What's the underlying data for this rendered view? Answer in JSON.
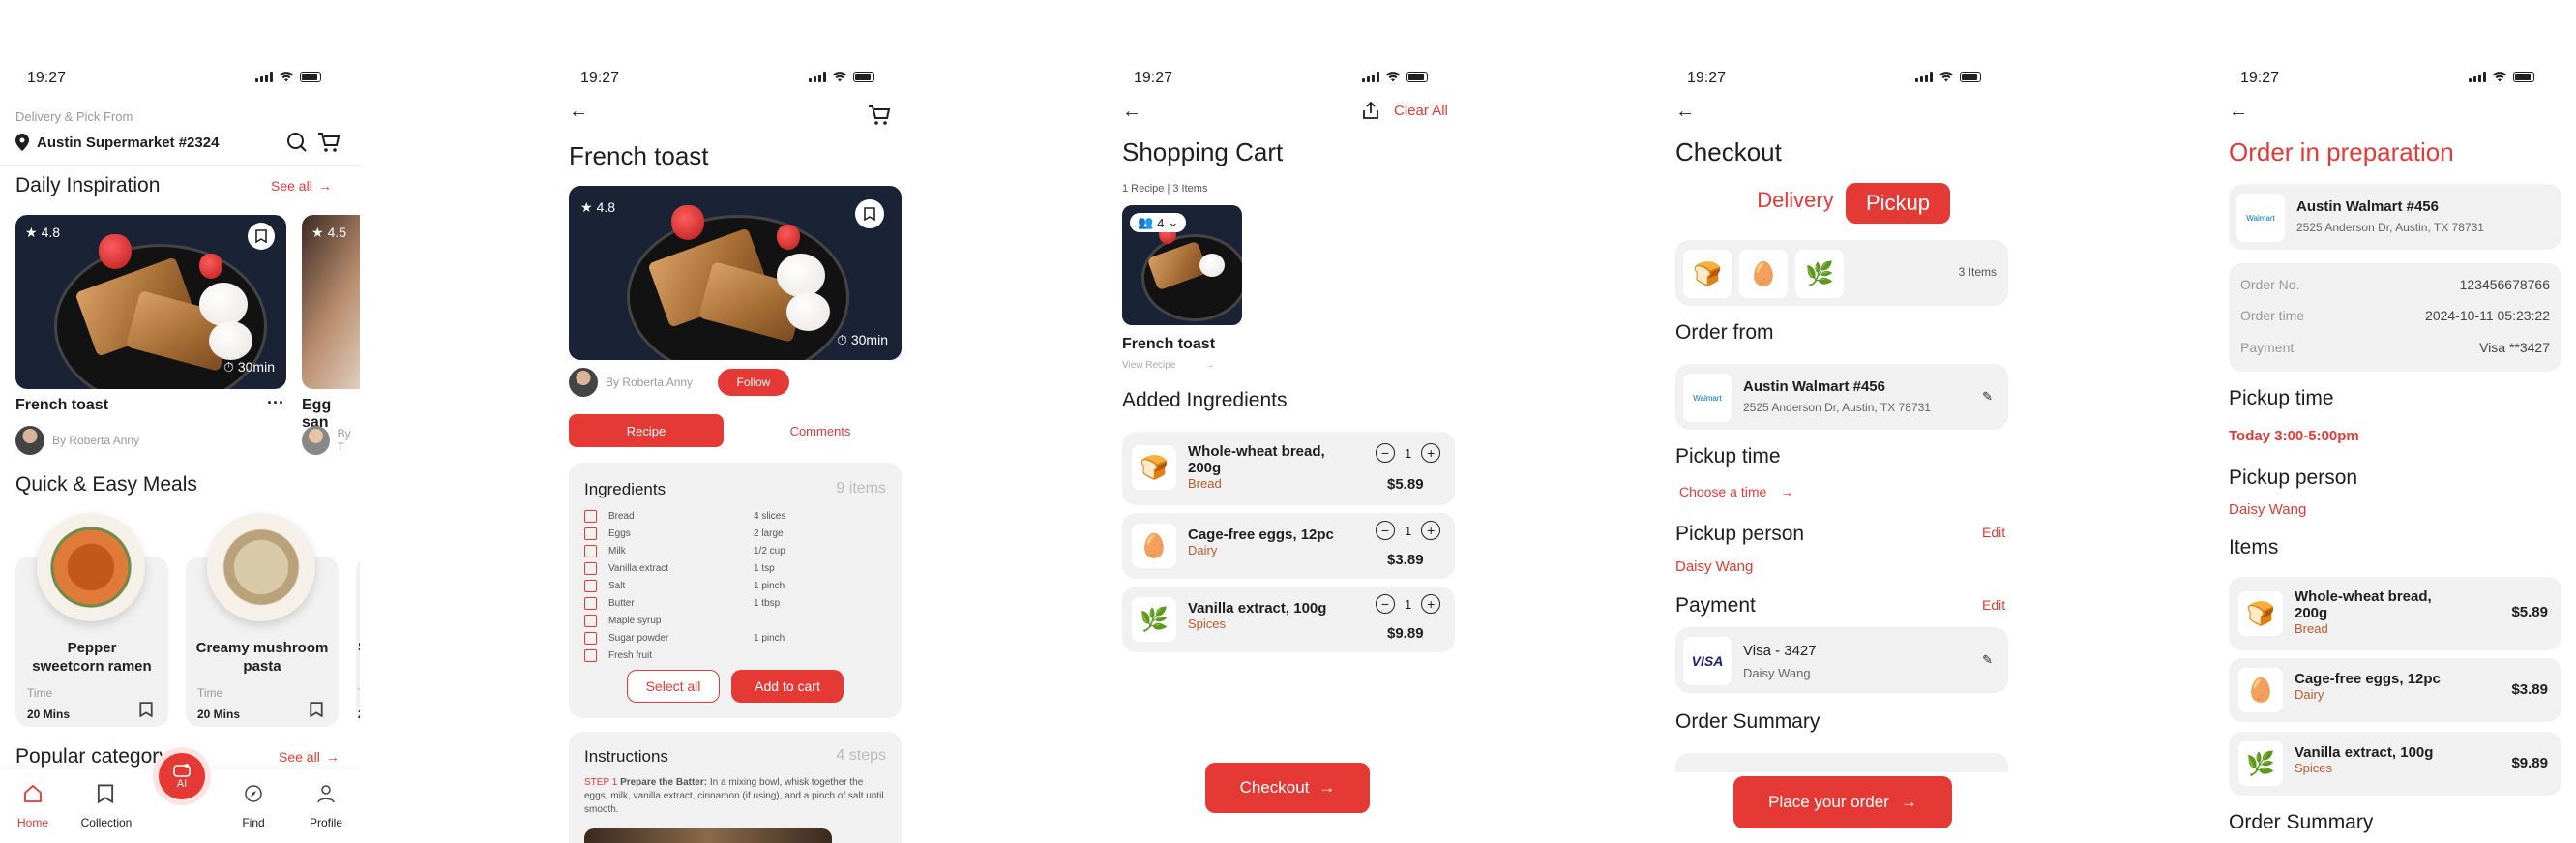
{
  "status_time": "19:27",
  "s1": {
    "location_label": "Delivery & Pick From",
    "store": "Austin Supermarket #2324",
    "daily_title": "Daily Inspiration",
    "see_all": "See all",
    "cards": [
      {
        "rating": "4.8",
        "time": "30min",
        "title": "French toast",
        "author": "By Roberta Anny"
      },
      {
        "rating": "4.5",
        "title": "Egg san",
        "author": "By T"
      }
    ],
    "quick_title": "Quick & Easy Meals",
    "meals": [
      {
        "name": "Pepper sweetcorn ramen",
        "time_label": "Time",
        "time": "20 Mins"
      },
      {
        "name": "Creamy mushroom pasta",
        "time_label": "Time",
        "time": "20 Mins"
      },
      {
        "name": "S",
        "time_label": "T",
        "time": "2"
      }
    ],
    "popular_title": "Popular category",
    "popular_see_all": "See all",
    "tabs": [
      "Home",
      "Collection",
      "AI",
      "Find",
      "Profile"
    ]
  },
  "s2": {
    "title": "French toast",
    "rating": "4.8",
    "time": "30min",
    "author": "By Roberta Anny",
    "follow": "Follow",
    "tab_recipe": "Recipe",
    "tab_comments": "Comments",
    "ingredients_title": "Ingredients",
    "ingredients_count": "9 items",
    "ingredients": [
      {
        "name": "Bread",
        "qty": "4 slices"
      },
      {
        "name": "Eggs",
        "qty": "2 large"
      },
      {
        "name": "Milk",
        "qty": "1/2 cup"
      },
      {
        "name": "Vanilla extract",
        "qty": "1 tsp"
      },
      {
        "name": "Salt",
        "qty": "1 pinch"
      },
      {
        "name": "Butter",
        "qty": "1 tbsp"
      },
      {
        "name": "Maple syrup",
        "qty": ""
      },
      {
        "name": "Sugar powder",
        "qty": "1 pinch"
      },
      {
        "name": "Fresh fruit",
        "qty": ""
      }
    ],
    "select_all": "Select all",
    "add_to_cart": "Add to cart",
    "instructions_title": "Instructions",
    "instructions_count": "4 steps",
    "step_label": "STEP 1",
    "step_title": "Prepare the Batter:",
    "step_text": "In a mixing bowl, whisk together the eggs, milk, vanilla extract, cinnamon (if using), and a pinch of salt until smooth."
  },
  "s3": {
    "clear_all": "Clear All",
    "title": "Shopping Cart",
    "summary": "1 Recipe | 3 Items",
    "servings": "4",
    "recipe_name": "French toast",
    "view_recipe": "View Recipe",
    "added_title": "Added Ingredients",
    "items": [
      {
        "name": "Whole-wheat bread, 200g",
        "cat": "Bread",
        "qty": "1",
        "price": "$5.89",
        "icon": "bread-icon",
        "glyph": "🍞"
      },
      {
        "name": "Cage-free eggs, 12pc",
        "cat": "Dairy",
        "qty": "1",
        "price": "$3.89",
        "icon": "egg-icon",
        "glyph": "🥚"
      },
      {
        "name": "Vanilla extract, 100g",
        "cat": "Spices",
        "qty": "1",
        "price": "$9.89",
        "icon": "herb-icon",
        "glyph": "🌿"
      }
    ],
    "checkout": "Checkout"
  },
  "s4": {
    "title": "Checkout",
    "delivery": "Delivery",
    "pickup": "Pickup",
    "items_count": "3 Items",
    "order_from": "Order from",
    "store_logo": "Walmart",
    "store_name": "Austin Walmart #456",
    "store_addr": "2525 Anderson Dr, Austin, TX 78731",
    "pickup_time": "Pickup time",
    "choose_time": "Choose a time",
    "pickup_person": "Pickup person",
    "edit": "Edit",
    "person": "Daisy Wang",
    "payment": "Payment",
    "payment_edit": "Edit",
    "card_brand": "VISA",
    "card_name": "Visa - 3427",
    "card_holder": "Daisy Wang",
    "order_summary": "Order Summary",
    "place_order": "Place your order"
  },
  "s5": {
    "title": "Order in preparation",
    "store_logo": "Walmart",
    "store_name": "Austin Walmart #456",
    "store_addr": "2525 Anderson Dr, Austin, TX 78731",
    "details": [
      {
        "label": "Order No.",
        "value": "123456678766"
      },
      {
        "label": "Order time",
        "value": "2024-10-11 05:23:22"
      },
      {
        "label": "Payment",
        "value": "Visa **3427"
      }
    ],
    "pickup_time": "Pickup time",
    "pickup_time_value": "Today 3:00-5:00pm",
    "pickup_person": "Pickup person",
    "person": "Daisy Wang",
    "items_title": "Items",
    "items": [
      {
        "name": "Whole-wheat bread, 200g",
        "cat": "Bread",
        "price": "$5.89",
        "glyph": "🍞"
      },
      {
        "name": "Cage-free eggs, 12pc",
        "cat": "Dairy",
        "price": "$3.89",
        "glyph": "🥚"
      },
      {
        "name": "Vanilla extract, 100g",
        "cat": "Spices",
        "price": "$9.89",
        "glyph": "🌿"
      }
    ],
    "order_summary": "Order Summary"
  }
}
